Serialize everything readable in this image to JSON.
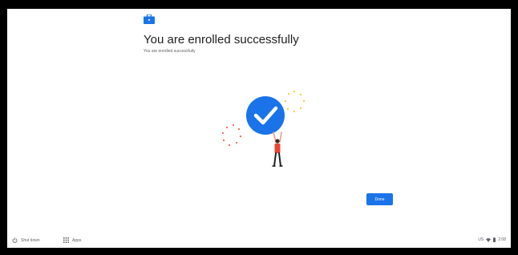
{
  "header": {
    "icon": "briefcase-icon",
    "title": "You are enrolled successfully",
    "subtitle": "You are enrolled successfully"
  },
  "actions": {
    "done_label": "Done"
  },
  "shelf": {
    "shutdown_icon": "power-icon",
    "shutdown_label": "Shut down",
    "apps_icon": "apps-grid-icon",
    "apps_label": "Apps"
  },
  "status": {
    "locale": "US",
    "wifi_icon": "wifi-icon",
    "battery_icon": "battery-icon",
    "time": "2:08"
  },
  "colors": {
    "accent": "#1a73e8",
    "background": "#ffffff",
    "frame": "#000000"
  }
}
